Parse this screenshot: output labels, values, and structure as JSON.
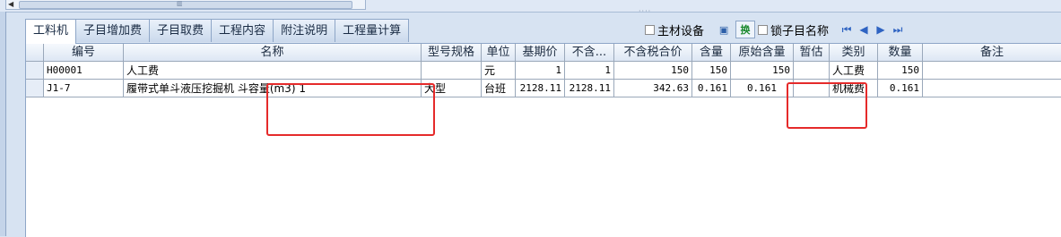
{
  "scrollbar": {
    "grip": "▥"
  },
  "tabs": [
    "工料机",
    "子目增加费",
    "子目取费",
    "工程内容",
    "附注说明",
    "工程量计算"
  ],
  "toolbar": {
    "main_equipment_label": "主材设备",
    "swap_label": "换",
    "lock_name_label": "锁子目名称",
    "icons": [
      "monitor-icon",
      "first-page-icon",
      "prev-icon",
      "next-icon",
      "last-page-icon"
    ]
  },
  "table": {
    "columns": [
      "编号",
      "名称",
      "型号规格",
      "单位",
      "基期价",
      "不含...",
      "不含税合价",
      "含量",
      "原始含量",
      "暂估",
      "类别",
      "数量",
      "备注"
    ],
    "rows": [
      {
        "code": "H00001",
        "name": "人工费",
        "spec": "",
        "unit": "元",
        "base_price": "1",
        "excl_tax": "1",
        "excl_tax_total": "150",
        "content": "150",
        "orig_content": "150",
        "est": "",
        "category": "人工费",
        "qty": "150",
        "remark": ""
      },
      {
        "code": "J1-7",
        "name": "履带式单斗液压挖掘机 斗容量(m3) 1",
        "spec": "大型",
        "unit": "台班",
        "base_price": "2128.11",
        "excl_tax": "2128.11",
        "excl_tax_total": "342.63",
        "content": "0.161",
        "orig_content": "0.161",
        "est": "",
        "category": "机械费",
        "qty": "0.161",
        "remark": ""
      }
    ]
  },
  "colors": {
    "annotation": "#e52a2a",
    "nav": "#2e63c2",
    "swap": "#1c8a2f"
  }
}
